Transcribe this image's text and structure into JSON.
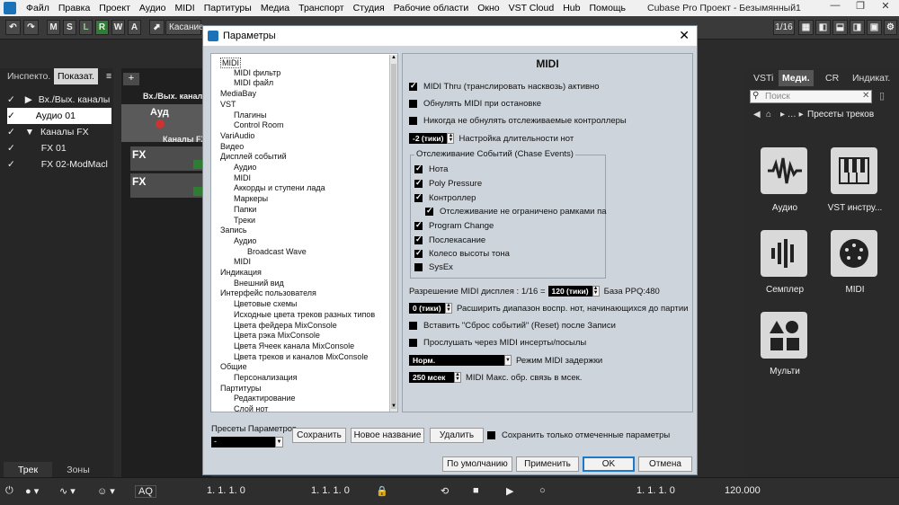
{
  "menubar": {
    "items": [
      "Файл",
      "Правка",
      "Проект",
      "Аудио",
      "MIDI",
      "Партитуры",
      "Медиа",
      "Транспорт",
      "Студия",
      "Рабочие области",
      "Окно",
      "VST Cloud",
      "Hub",
      "Помощь"
    ],
    "title": "Cubase Pro Проект - Безымянный1"
  },
  "toolbar": {
    "buttons": [
      "M",
      "S",
      "L",
      "R",
      "W",
      "A"
    ],
    "touch_mode": "Касание",
    "quantize": "1/16"
  },
  "left_panel": {
    "tabs": [
      "Инспекто.",
      "Показат."
    ],
    "tracks": [
      "Вх./Вых. каналы",
      "Аудио 01",
      "Каналы FX",
      "FX 01",
      "FX 02-ModMacl"
    ],
    "bottom_tabs": [
      "Трек",
      "Зоны"
    ]
  },
  "project": {
    "header": "Вх./Вых. каналы",
    "audio_track": "Ауд",
    "fx_channel": "Каналы FX",
    "fx_rows": [
      "FX",
      "FX"
    ],
    "row_nums": [
      "1",
      "2",
      "3"
    ]
  },
  "right_panel": {
    "tabs": [
      "VSTi",
      "Меди.",
      "CR",
      "Индикат."
    ],
    "search_placeholder": "Поиск",
    "breadcrumb": "Пресеты треков",
    "tiles": [
      "Аудио",
      "VST инстру...",
      "Семплер",
      "MIDI",
      "Мульти"
    ]
  },
  "transport": {
    "pos_left": "1. 1. 1.   0",
    "pos_mid": "1. 1. 1.   0",
    "pos_right": "1. 1. 1.   0",
    "tempo": "120.000",
    "aq": "AQ"
  },
  "dialog": {
    "title": "Параметры",
    "tree": [
      {
        "label": "MIDI",
        "level": 0,
        "selected": true
      },
      {
        "label": "MIDI фильтр",
        "level": 1
      },
      {
        "label": "MIDI файл",
        "level": 1
      },
      {
        "label": "MediaBay",
        "level": 0
      },
      {
        "label": "VST",
        "level": 0
      },
      {
        "label": "Плагины",
        "level": 1
      },
      {
        "label": "Control Room",
        "level": 1
      },
      {
        "label": "VariAudio",
        "level": 0
      },
      {
        "label": "Видео",
        "level": 0
      },
      {
        "label": "Дисплей событий",
        "level": 0
      },
      {
        "label": "Аудио",
        "level": 1
      },
      {
        "label": "MIDI",
        "level": 1
      },
      {
        "label": "Аккорды и ступени лада",
        "level": 1
      },
      {
        "label": "Маркеры",
        "level": 1
      },
      {
        "label": "Папки",
        "level": 1
      },
      {
        "label": "Треки",
        "level": 1
      },
      {
        "label": "Запись",
        "level": 0
      },
      {
        "label": "Аудио",
        "level": 1
      },
      {
        "label": "Broadcast Wave",
        "level": 2
      },
      {
        "label": "MIDI",
        "level": 1
      },
      {
        "label": "Индикация",
        "level": 0
      },
      {
        "label": "Внешний вид",
        "level": 1
      },
      {
        "label": "Интерфейс пользователя",
        "level": 0
      },
      {
        "label": "Цветовые схемы",
        "level": 1
      },
      {
        "label": "Исходные цвета треков разных типов",
        "level": 1
      },
      {
        "label": "Цвета фейдера MixConsole",
        "level": 1
      },
      {
        "label": "Цвета рэка MixConsole",
        "level": 1
      },
      {
        "label": "Цвета Ячеек канала MixConsole",
        "level": 1
      },
      {
        "label": "Цвета треков и каналов MixConsole",
        "level": 1
      },
      {
        "label": "Общие",
        "level": 0
      },
      {
        "label": "Персонализация",
        "level": 1
      },
      {
        "label": "Партитуры",
        "level": 0
      },
      {
        "label": "Редактирование",
        "level": 1
      },
      {
        "label": "Слой нот",
        "level": 1
      }
    ],
    "panel_title": "MIDI",
    "options": {
      "thru": "MIDI Thru (транслировать насквозь) активно",
      "reset_stop": "Обнулять MIDI при остановке",
      "never_reset": "Никогда не обнулять отслеживаемые контроллеры",
      "length_val": "-2 (тики)",
      "length_label": "Настройка длительности нот"
    },
    "chase": {
      "title": "Отслеживание Событий (Chase Events)",
      "items": [
        "Нота",
        "Poly Pressure",
        "Контроллер",
        "Отслеживание не ограничено рамками партии",
        "Program Change",
        "Послекасание",
        "Колесо высоты тона",
        "SysEx"
      ]
    },
    "resolution": {
      "label": "Разрешение MIDI дисплея : 1/16 =",
      "value": "120 (тики)",
      "ppq": "База PPQ:480"
    },
    "extend": {
      "value": "0 (тики)",
      "label": "Расширить диапазон воспр. нот, начинающихся до партии"
    },
    "insert_reset": "Вставить \"Сброс событий\" (Reset) после Записи",
    "audition": "Прослушать через MIDI инсерты/посылы",
    "latency": {
      "value": "Норм.",
      "label": "Режим MIDI задержки"
    },
    "feedback": {
      "value": "250 мсек",
      "label": "MIDI Макс. обр. связь в мсек."
    },
    "presets_label": "Пресеты Параметров",
    "presets_value": "-",
    "btn_save": "Сохранить",
    "btn_rename": "Новое название",
    "btn_delete": "Удалить",
    "save_marked": "Сохранить только отмеченные параметры",
    "btn_default": "По умолчанию",
    "btn_apply": "Применить",
    "btn_ok": "OK",
    "btn_cancel": "Отмена"
  }
}
